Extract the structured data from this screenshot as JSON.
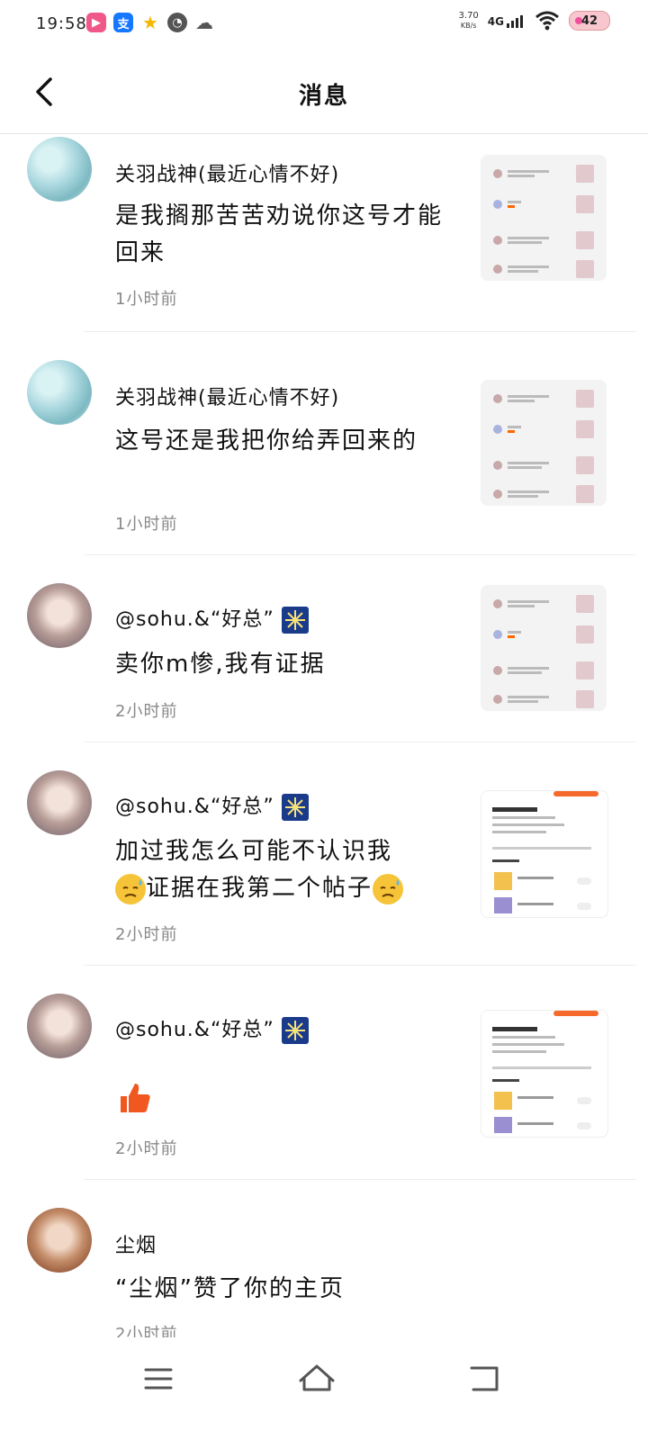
{
  "status_bar": {
    "time": "19:58",
    "net_speed_value": "3.70",
    "net_speed_unit": "KB/s",
    "net_type": "4G",
    "battery": "42"
  },
  "header": {
    "title": "消息"
  },
  "messages": [
    {
      "sender": "关羽战神(最近心情不好)",
      "content": "是我搁那苦苦劝说你这号才能回来",
      "time": "1小时前"
    },
    {
      "sender": "关羽战神(最近心情不好)",
      "content": "这号还是我把你给弄回来的",
      "time": "1小时前"
    },
    {
      "sender": "@sohu.&“好总”",
      "content": "卖你m惨,我有证据",
      "time": "2小时前"
    },
    {
      "sender": "@sohu.&“好总”",
      "content_a": "加过我怎么可能不认识我",
      "content_b": "证据在我第二个帖子",
      "time": "2小时前"
    },
    {
      "sender": "@sohu.&“好总”",
      "content": "",
      "time": "2小时前"
    },
    {
      "sender": "尘烟",
      "content": "“尘烟”赞了你的主页",
      "time": "2小时前"
    }
  ]
}
